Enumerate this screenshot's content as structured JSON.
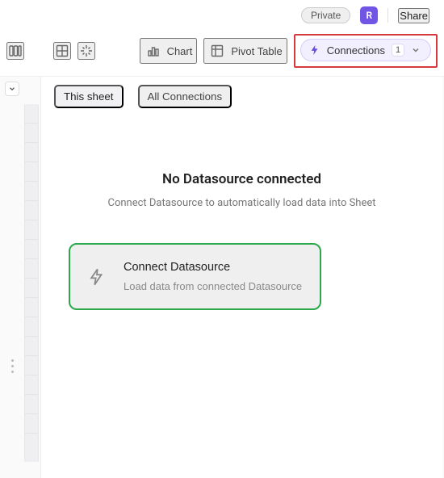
{
  "header": {
    "private_label": "Private",
    "avatar_initial": "R",
    "share_label": "Share"
  },
  "toolbar": {
    "chart_label": "Chart",
    "pivot_label": "Pivot Table",
    "connections_label": "Connections",
    "connections_count": "1"
  },
  "panel": {
    "tabs": {
      "this_sheet": "This sheet",
      "all_connections": "All Connections"
    },
    "empty_title": "No Datasource connected",
    "empty_sub": "Connect Datasource to automatically load data into Sheet",
    "card_title": "Connect Datasource",
    "card_sub": "Load data from connected Datasource"
  }
}
